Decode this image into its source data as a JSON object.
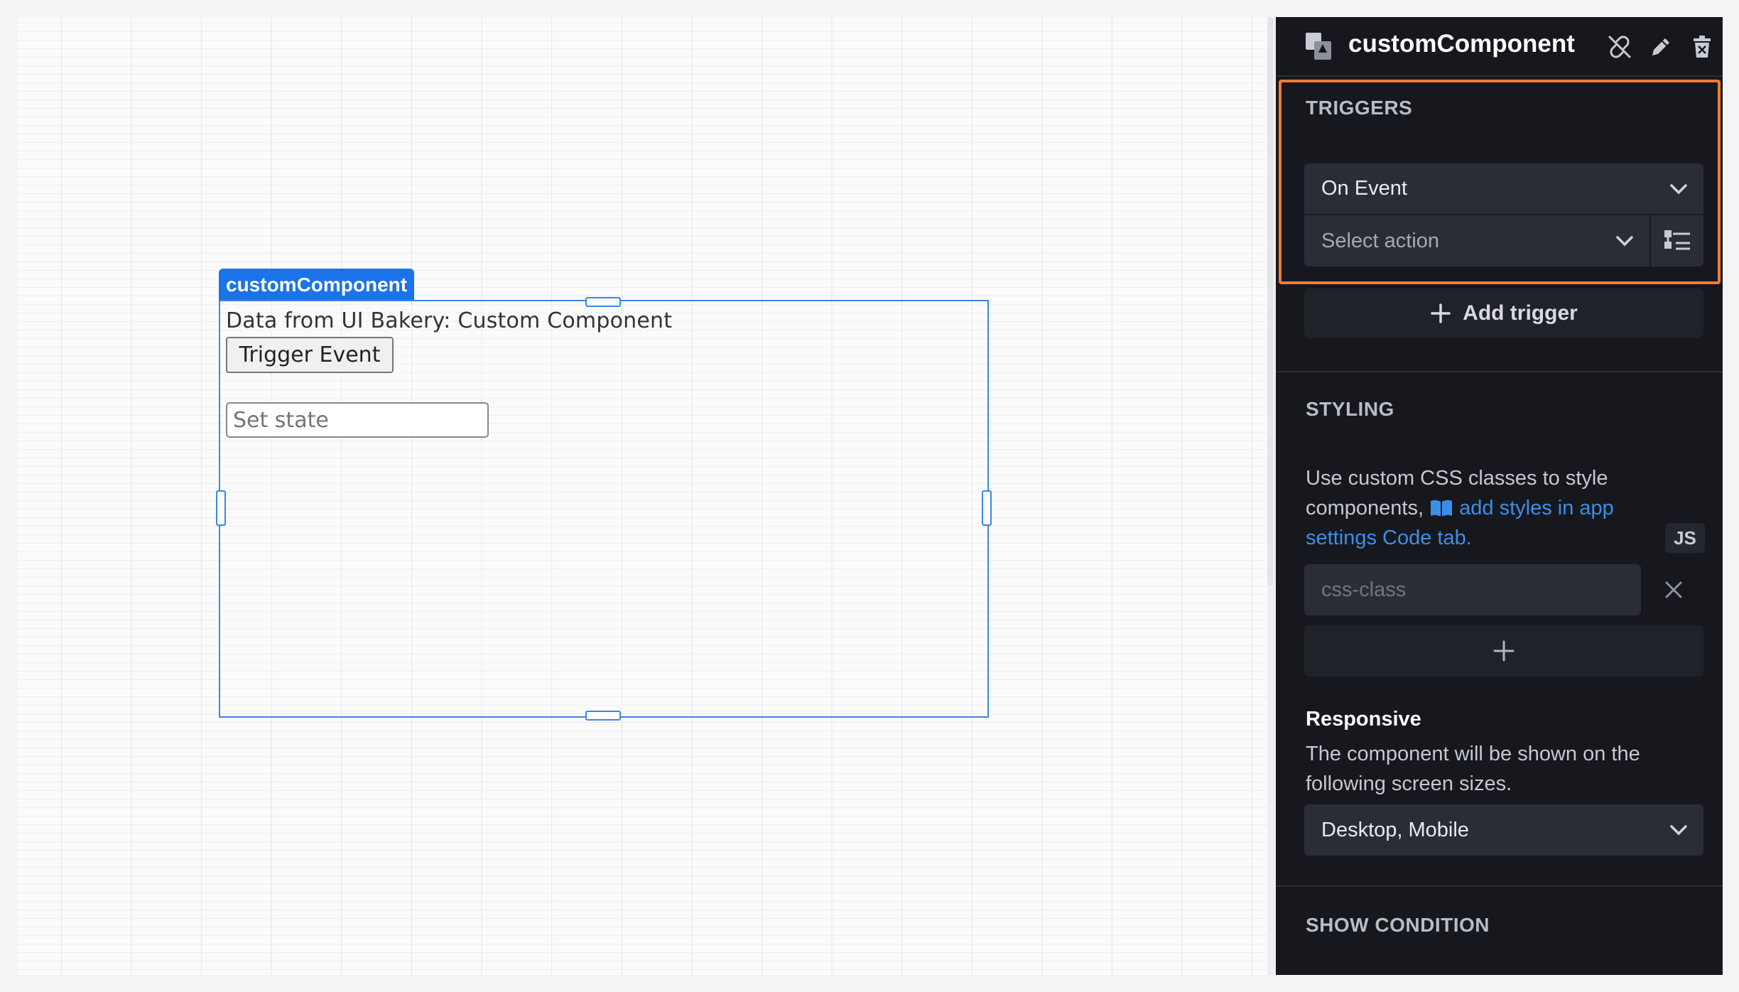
{
  "canvas": {
    "component_label": "customComponent",
    "component_text": "Data from UI Bakery: Custom Component",
    "trigger_button": "Trigger Event",
    "state_placeholder": "Set state"
  },
  "panel": {
    "title": "customComponent",
    "header_icons": [
      "component-icon",
      "unlink-icon",
      "edit-icon",
      "delete-icon"
    ],
    "triggers": {
      "section_title": "TRIGGERS",
      "event_select": "On Event",
      "action_placeholder": "Select action",
      "add_trigger": "Add trigger"
    },
    "styling": {
      "section_title": "STYLING",
      "desc_prefix": "Use custom CSS classes to style components,",
      "link_text": "add styles in app settings Code tab.",
      "js_badge": "JS",
      "css_input_placeholder": "css-class"
    },
    "responsive": {
      "title": "Responsive",
      "description": "The component will be shown on the following screen sizes.",
      "value": "Desktop, Mobile"
    },
    "show_condition": {
      "section_title": "SHOW CONDITION"
    }
  },
  "colors": {
    "selection_blue": "#1a73e8",
    "panel_bg": "#16181d",
    "highlight_orange": "#f07c34",
    "link_blue": "#3b8fea"
  }
}
